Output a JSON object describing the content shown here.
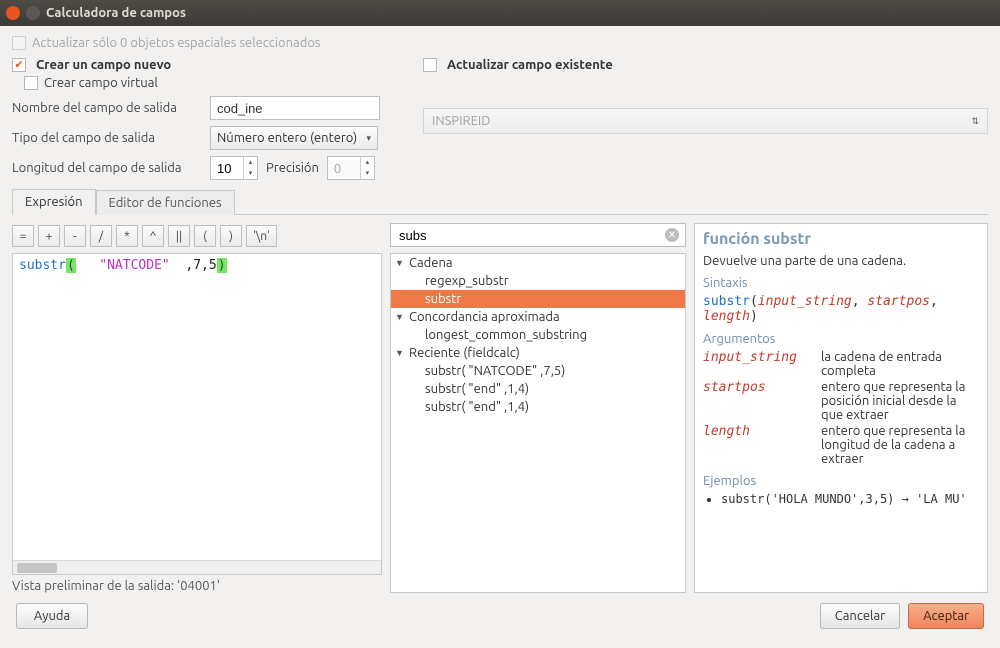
{
  "window": {
    "title": "Calculadora de campos"
  },
  "topbar": {
    "update_selected": "Actualizar sólo 0 objetos espaciales seleccionados",
    "create_new": "Crear un campo nuevo",
    "create_virtual": "Crear campo virtual",
    "update_existing": "Actualizar campo existente"
  },
  "form": {
    "out_name_label": "Nombre del campo de salida",
    "out_name_value": "cod_ine",
    "out_type_label": "Tipo del campo de salida",
    "out_type_value": "Número entero (entero)",
    "out_len_label": "Longitud del campo de salida",
    "out_len_value": "10",
    "precision_label": "Precisión",
    "precision_value": "0",
    "existing_field": "INSPIREID"
  },
  "tabs": {
    "expr": "Expresión",
    "func_editor": "Editor de funciones"
  },
  "ops": [
    "=",
    "+",
    "-",
    "/",
    "*",
    "^",
    "||",
    "(",
    ")",
    "'\\n'"
  ],
  "expr": {
    "fn": "substr",
    "str": "\"NATCODE\"",
    "tail": " ,7,5"
  },
  "search_value": "subs",
  "tree": {
    "g1": "Cadena",
    "g1_items": [
      "regexp_substr",
      "substr"
    ],
    "g2": "Concordancia aproximada",
    "g2_items": [
      "longest_common_substring"
    ],
    "g3": "Reciente (fieldcalc)",
    "g3_items": [
      "substr( \"NATCODE\" ,7,5)",
      "substr( \"end\" ,1,4)",
      "substr( \"end\" ,1,4)"
    ]
  },
  "help": {
    "title": "función substr",
    "desc": "Devuelve una parte de una cadena.",
    "h_syntax": "Sintaxis",
    "syntax_fn": "substr",
    "syntax_args": [
      "input_string",
      "startpos",
      "length"
    ],
    "h_args": "Argumentos",
    "args": [
      {
        "name": "input_string",
        "desc": "la cadena de entrada completa"
      },
      {
        "name": "startpos",
        "desc": "entero que representa la posición inicial desde la que extraer"
      },
      {
        "name": "length",
        "desc": "entero que representa la longitud de la cadena a extraer"
      }
    ],
    "h_examples": "Ejemplos",
    "example": "substr('HOLA MUNDO',3,5) → 'LA MU'"
  },
  "preview_label": "Vista preliminar de la salida:",
  "preview_value": "'04001'",
  "buttons": {
    "help": "Ayuda",
    "cancel": "Cancelar",
    "ok": "Aceptar"
  }
}
